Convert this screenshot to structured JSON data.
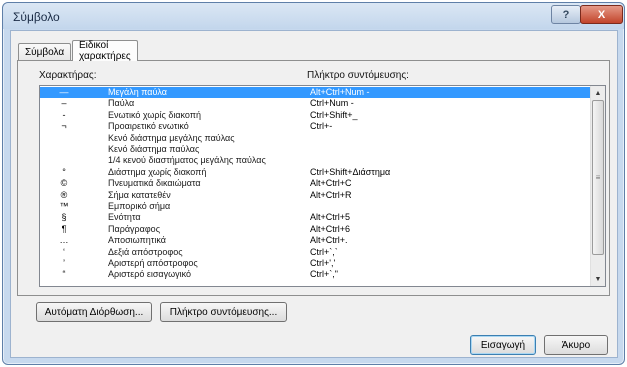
{
  "window": {
    "title": "Σύμβολο",
    "help_glyph": "?",
    "close_glyph": "X"
  },
  "tabs": [
    {
      "label": "Σύμβολα",
      "active": false
    },
    {
      "label": "Ειδικοί χαρακτήρες",
      "active": true
    }
  ],
  "columns": {
    "character": "Χαρακτήρας:",
    "shortcut": "Πλήκτρο συντόμευσης:"
  },
  "rows": [
    {
      "symbol": "—",
      "name": "Μεγάλη παύλα",
      "shortcut": "Alt+Ctrl+Num -",
      "selected": true
    },
    {
      "symbol": "–",
      "name": "Παύλα",
      "shortcut": "Ctrl+Num -"
    },
    {
      "symbol": "‑",
      "name": "Ενωτικό χωρίς διακοπή",
      "shortcut": "Ctrl+Shift+_"
    },
    {
      "symbol": "¬",
      "name": "Προαιρετικό ενωτικό",
      "shortcut": "Ctrl+-"
    },
    {
      "symbol": "",
      "name": "Κενό διάστημα μεγάλης παύλας",
      "shortcut": ""
    },
    {
      "symbol": "",
      "name": "Κενό διάστημα παύλας",
      "shortcut": ""
    },
    {
      "symbol": "",
      "name": "1/4 κενού διαστήματος μεγάλης παύλας",
      "shortcut": ""
    },
    {
      "symbol": "°",
      "name": "Διάστημα χωρίς διακοπή",
      "shortcut": "Ctrl+Shift+Διάστημα"
    },
    {
      "symbol": "©",
      "name": "Πνευματικά δικαιώματα",
      "shortcut": "Alt+Ctrl+C"
    },
    {
      "symbol": "®",
      "name": "Σήμα κατατεθέν",
      "shortcut": "Alt+Ctrl+R"
    },
    {
      "symbol": "™",
      "name": "Εμπορικό σήμα",
      "shortcut": ""
    },
    {
      "symbol": "§",
      "name": "Ενότητα",
      "shortcut": "Alt+Ctrl+5"
    },
    {
      "symbol": "¶",
      "name": "Παράγραφος",
      "shortcut": "Alt+Ctrl+6"
    },
    {
      "symbol": "…",
      "name": "Αποσιωπητικά",
      "shortcut": "Alt+Ctrl+."
    },
    {
      "symbol": "‘",
      "name": "Δεξιά απόστροφος",
      "shortcut": "Ctrl+`,`"
    },
    {
      "symbol": "’",
      "name": "Αριστερή απόστροφος",
      "shortcut": "Ctrl+','"
    },
    {
      "symbol": "“",
      "name": "Αριστερό εισαγωγικό",
      "shortcut": "Ctrl+`,\""
    }
  ],
  "buttons": {
    "autocorrect": "Αυτόματη Διόρθωση...",
    "shortcut_key": "Πλήκτρο συντόμευσης...",
    "insert": "Εισαγωγή",
    "cancel": "Άκυρο"
  },
  "colors": {
    "selection": "#3399ff",
    "frame": "#c7d9ee",
    "close": "#c2442b"
  },
  "icons": {
    "scroll_up": "▲",
    "scroll_down": "▼",
    "scroll_grip": "≡"
  }
}
